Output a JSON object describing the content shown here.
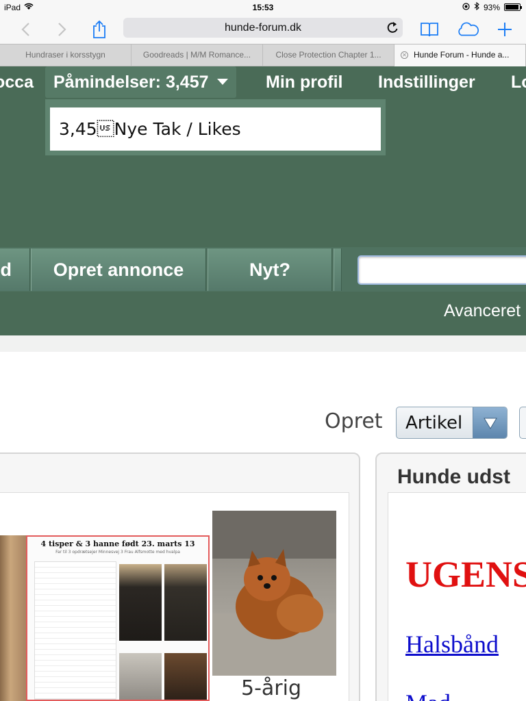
{
  "status_bar": {
    "device": "iPad",
    "time": "15:53",
    "battery_text": "93%",
    "battery_level": 0.93
  },
  "browser": {
    "url": "hunde-forum.dk",
    "tabs": [
      {
        "label": "Hundraser i korsstygn"
      },
      {
        "label": "Goodreads | M/M Romance..."
      },
      {
        "label": "Close Protection Chapter 1..."
      },
      {
        "label": "Hunde Forum - Hunde a...",
        "active": true
      }
    ]
  },
  "site_nav": {
    "user_partial": "occa",
    "reminders": "Påmindelser: 3,457",
    "profile": "Min profil",
    "settings": "Indstillinger",
    "logout_partial": "Lo"
  },
  "reminders_dropdown": {
    "item": "3,45\u001fNye Tak / Likes"
  },
  "menu_bar": {
    "partial_left": "d",
    "create_ad": "Opret annonce",
    "new": "Nyt?",
    "search_value": "",
    "advanced": "Avanceret"
  },
  "content": {
    "create_label": "Opret",
    "create_select_value": "Artikel",
    "right_panel_title": "Hunde udst",
    "image_caption": "5-årig",
    "ugens_heading": "UGENS",
    "link_halsband": "Halsbånd",
    "link_partial": "Mad",
    "flyer": {
      "title": "4 tisper & 3 hanne født 23. marts 13",
      "subtitle": "Far til 3 opdrætsejer Minnesvej 3 Frau Alfsmotte med hvalpa"
    }
  },
  "colors": {
    "header_green": "#4a6b57",
    "ugens_red": "#e01010",
    "link_blue": "#0d0dcc"
  }
}
